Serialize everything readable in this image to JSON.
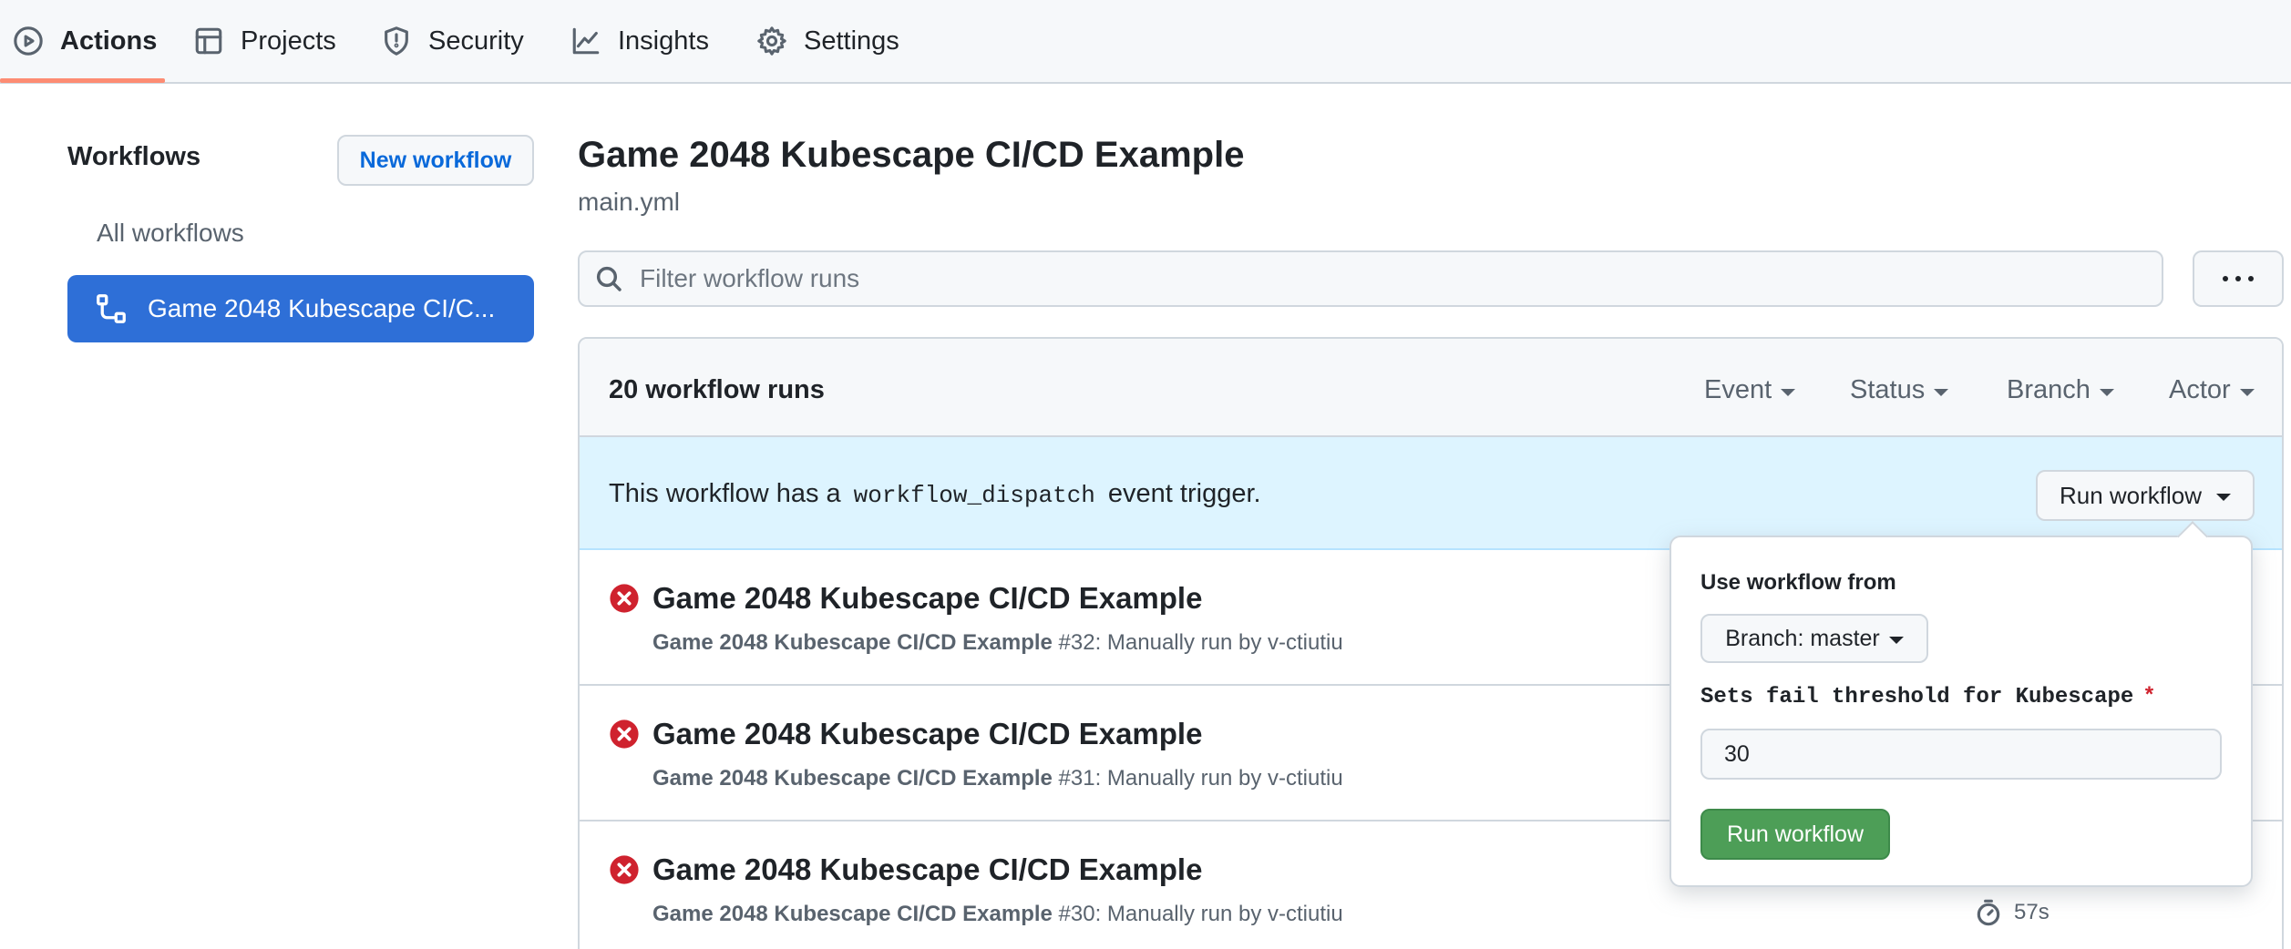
{
  "nav": {
    "tabs": [
      {
        "label": "Actions",
        "icon": "play-icon",
        "active": true
      },
      {
        "label": "Projects",
        "icon": "table-icon",
        "active": false
      },
      {
        "label": "Security",
        "icon": "shield-icon",
        "active": false
      },
      {
        "label": "Insights",
        "icon": "graph-icon",
        "active": false
      },
      {
        "label": "Settings",
        "icon": "gear-icon",
        "active": false
      }
    ],
    "active_underline_color": "#fd8c73"
  },
  "sidebar": {
    "title": "Workflows",
    "new_workflow_label": "New workflow",
    "all_workflows_label": "All workflows",
    "items": [
      {
        "label": "Game 2048 Kubescape CI/C...",
        "icon": "workflow-icon",
        "selected": true
      }
    ],
    "selected_color": "#2e6fd7"
  },
  "main": {
    "title": "Game 2048 Kubescape CI/CD Example",
    "file": "main.yml",
    "filter_placeholder": "Filter workflow runs",
    "runs_count": "20 workflow runs",
    "filters": [
      "Event",
      "Status",
      "Branch",
      "Actor"
    ],
    "dispatch": {
      "prefix": "This workflow has a",
      "code": "workflow_dispatch",
      "suffix": "event trigger.",
      "run_button": "Run workflow"
    },
    "runs": [
      {
        "title": "Game 2048 Kubescape CI/CD Example",
        "workflow": "Game 2048 Kubescape CI/CD Example",
        "detail": " #32: Manually run by v-ctiutiu",
        "status": "failed",
        "duration": ""
      },
      {
        "title": "Game 2048 Kubescape CI/CD Example",
        "workflow": "Game 2048 Kubescape CI/CD Example",
        "detail": " #31: Manually run by v-ctiutiu",
        "status": "failed",
        "duration": ""
      },
      {
        "title": "Game 2048 Kubescape CI/CD Example",
        "workflow": "Game 2048 Kubescape CI/CD Example",
        "detail": " #30: Manually run by v-ctiutiu",
        "status": "failed",
        "duration": "57s"
      }
    ],
    "status_fail_color": "#cf222e"
  },
  "popover": {
    "use_from_label": "Use workflow from",
    "branch_label": "Branch: master",
    "threshold_label": "Sets fail threshold for Kubescape",
    "required_mark": "*",
    "threshold_value": "30",
    "submit_label": "Run workflow",
    "submit_color": "#4d9e57"
  }
}
